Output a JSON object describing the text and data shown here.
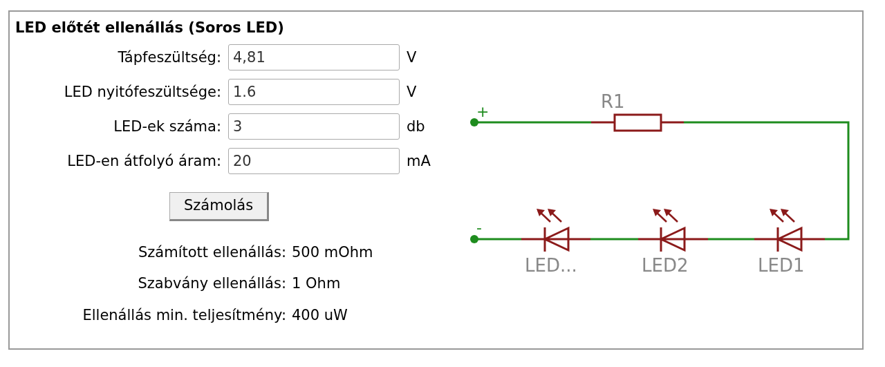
{
  "title": "LED előtét ellenállás (Soros LED)",
  "inputs": [
    {
      "label": "Tápfeszültség:",
      "value": "4,81",
      "unit": "V"
    },
    {
      "label": "LED nyitófeszültsége:",
      "value": "1.6",
      "unit": "V"
    },
    {
      "label": "LED-ek száma:",
      "value": "3",
      "unit": "db"
    },
    {
      "label": "LED-en átfolyó áram:",
      "value": "20",
      "unit": "mA"
    }
  ],
  "button": "Számolás",
  "results": [
    {
      "label": "Számított ellenállás:",
      "value": "500 mOhm"
    },
    {
      "label": "Szabvány ellenállás:",
      "value": "1 Ohm"
    },
    {
      "label": "Ellenállás min. teljesítmény:",
      "value": "400 uW"
    }
  ],
  "schematic": {
    "resistor_label": "R1",
    "positive_label": "+",
    "negative_label": "-",
    "leds": [
      {
        "label": "LED..."
      },
      {
        "label": "LED2"
      },
      {
        "label": "LED1"
      }
    ]
  }
}
